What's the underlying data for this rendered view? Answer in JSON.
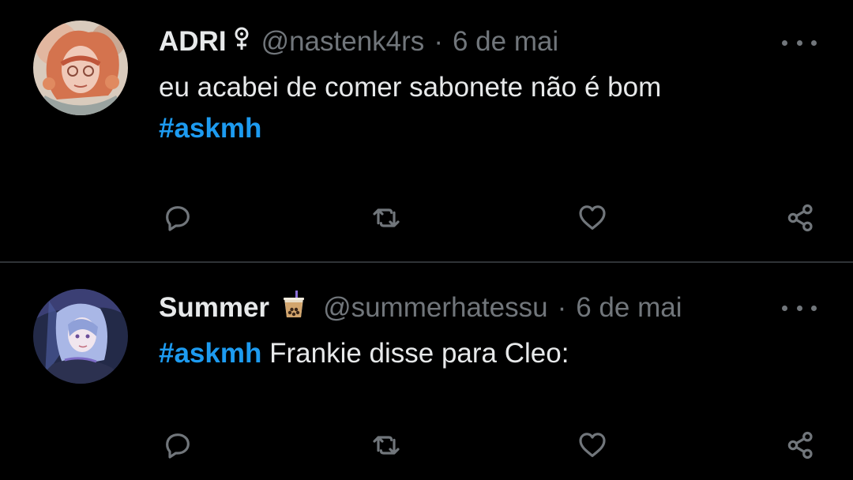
{
  "tweets": [
    {
      "display_name": "ADRI",
      "badge_icon": "female-symbol-icon",
      "handle": "@nastenk4rs",
      "separator": "·",
      "date": "6 de mai",
      "hashtag": "#askmh",
      "text_line1": "eu acabei de comer sabonete não é bom",
      "more_icon": "more-options-icon"
    },
    {
      "display_name": "Summer",
      "badge_icon": "bubble-tea-icon",
      "handle": "@summerhatessu",
      "separator": "·",
      "date": "6 de mai",
      "hashtag": "#askmh",
      "text_after_hashtag": " Frankie disse para Cleo:",
      "more_icon": "more-options-icon"
    }
  ],
  "action_icons": [
    "reply-icon",
    "retweet-icon",
    "like-icon",
    "share-icon"
  ],
  "colors": {
    "background": "#000000",
    "text": "#e7e9ea",
    "secondary": "#71767b",
    "accent": "#1d9bf0",
    "divider": "#2f3336"
  }
}
